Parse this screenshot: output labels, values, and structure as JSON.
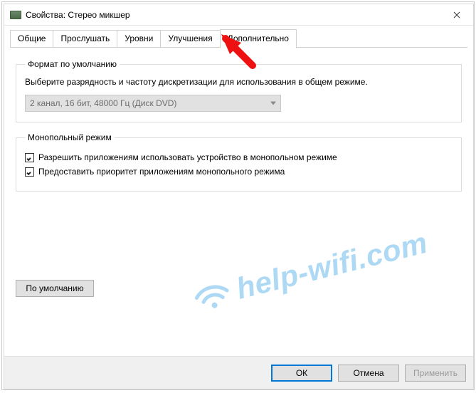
{
  "window": {
    "title": "Свойства: Стерео микшер"
  },
  "tabs": {
    "items": [
      {
        "label": "Общие"
      },
      {
        "label": "Прослушать"
      },
      {
        "label": "Уровни"
      },
      {
        "label": "Улучшения"
      },
      {
        "label": "Дополнительно"
      }
    ],
    "active_index": 4
  },
  "default_format": {
    "legend": "Формат по умолчанию",
    "description": "Выберите разрядность и частоту дискретизации для использования в общем режиме.",
    "selected": "2 канал, 16 бит, 48000 Гц (Диск DVD)"
  },
  "exclusive_mode": {
    "legend": "Монопольный режим",
    "option1": {
      "label": "Разрешить приложениям использовать устройство в монопольном режиме",
      "checked": true
    },
    "option2": {
      "label": "Предоставить приоритет приложениям монопольного режима",
      "checked": true
    }
  },
  "buttons": {
    "restore_default": "По умолчанию",
    "ok": "ОК",
    "cancel": "Отмена",
    "apply": "Применить"
  },
  "watermark": {
    "text": "help-wifi.com"
  }
}
